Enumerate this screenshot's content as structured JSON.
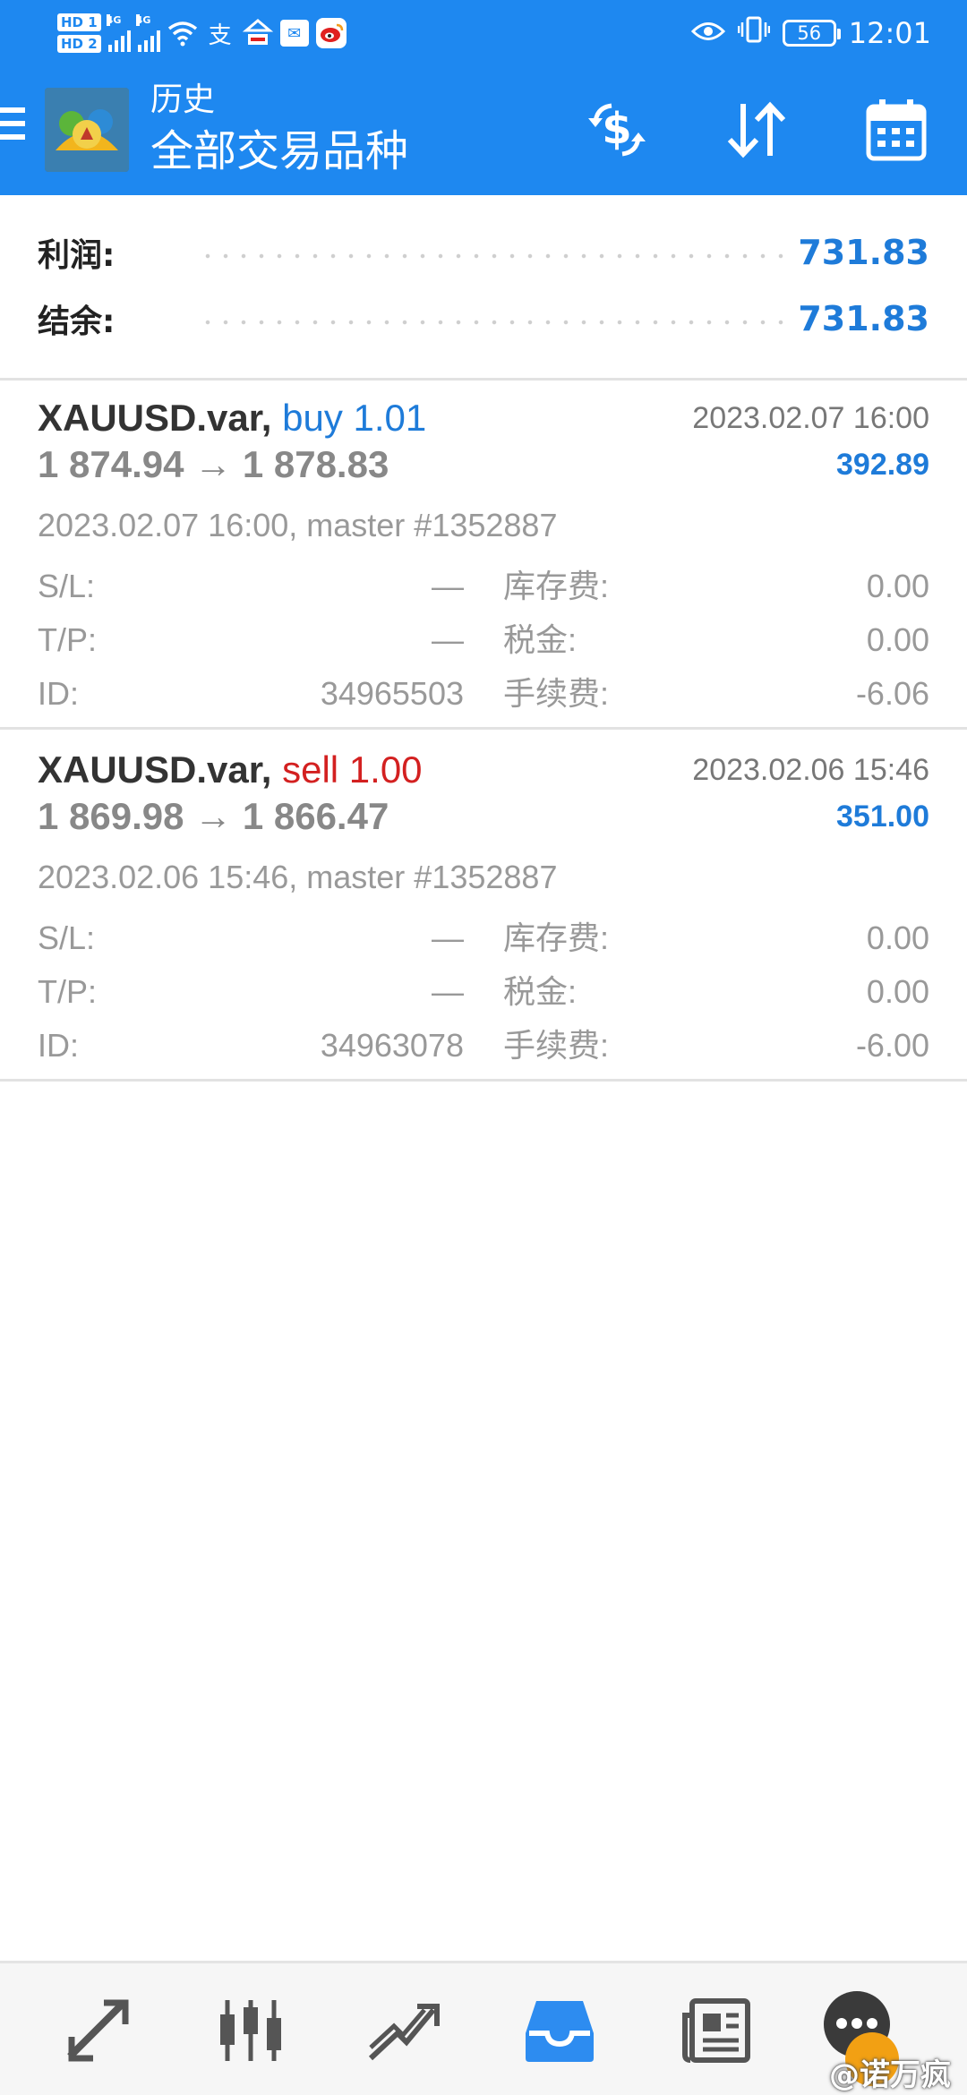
{
  "status_bar": {
    "hd1": "HD 1",
    "hd2": "HD 2",
    "net1": "4G",
    "net2": "4G",
    "battery": "56",
    "time": "12:01",
    "icons": [
      "wifi-icon",
      "alipay-icon",
      "app-icon",
      "mail-icon",
      "weibo-icon",
      "eye-icon",
      "vibrate-icon"
    ]
  },
  "app_bar": {
    "title": "历史",
    "subtitle": "全部交易品种",
    "actions": [
      "currency-swap-icon",
      "sort-icon",
      "calendar-icon"
    ]
  },
  "summary": {
    "profit_label": "利润:",
    "profit_value": "731.83",
    "balance_label": "结余:",
    "balance_value": "731.83"
  },
  "deals": [
    {
      "symbol": "XAUUSD.var,",
      "side": "buy 1.01",
      "time": "2023.02.07 16:00",
      "prices": "1 874.94 → 1 878.83",
      "profit": "392.89",
      "info": "2023.02.07 16:00, master #1352887",
      "sl_label": "S/L:",
      "sl_value": "—",
      "tp_label": "T/P:",
      "tp_value": "—",
      "id_label": "ID:",
      "id_value": "34965503",
      "swap_label": "库存费:",
      "swap_value": "0.00",
      "tax_label": "税金:",
      "tax_value": "0.00",
      "fee_label": "手续费:",
      "fee_value": "-6.06"
    },
    {
      "symbol": "XAUUSD.var,",
      "side": "sell 1.00",
      "time": "2023.02.06 15:46",
      "prices": "1 869.98 → 1 866.47",
      "profit": "351.00",
      "info": "2023.02.06 15:46, master #1352887",
      "sl_label": "S/L:",
      "sl_value": "—",
      "tp_label": "T/P:",
      "tp_value": "—",
      "id_label": "ID:",
      "id_value": "34963078",
      "swap_label": "库存费:",
      "swap_value": "0.00",
      "tax_label": "税金:",
      "tax_value": "0.00",
      "fee_label": "手续费:",
      "fee_value": "-6.00"
    }
  ],
  "bottom_nav": {
    "items": [
      "quotes-icon",
      "chart-candles-icon",
      "trade-icon",
      "history-icon",
      "news-icon"
    ],
    "active": "history-icon"
  },
  "watermark": "@诺万疯",
  "colors": {
    "primary": "#1e88f0",
    "profit_blue": "#1e7bd9",
    "sell_red": "#d32020",
    "muted_gray": "#999999"
  }
}
